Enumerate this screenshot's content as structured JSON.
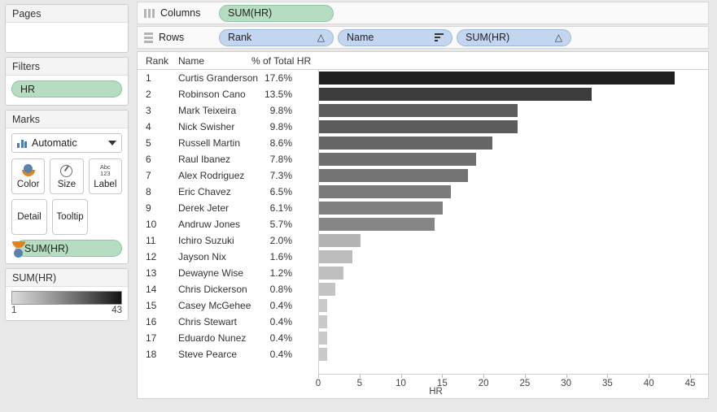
{
  "left_panel": {
    "pages": {
      "title": "Pages"
    },
    "filters": {
      "title": "Filters",
      "pills": [
        {
          "label": "HR"
        }
      ]
    },
    "marks": {
      "title": "Marks",
      "mark_type": "Automatic",
      "buttons": [
        {
          "label": "Color",
          "icon": "color-icon"
        },
        {
          "label": "Size",
          "icon": "size-icon"
        },
        {
          "label": "Label",
          "icon": "abc-123-icon"
        },
        {
          "label": "Detail",
          "icon": ""
        },
        {
          "label": "Tooltip",
          "icon": ""
        }
      ],
      "encoding_pills": [
        {
          "label": "SUM(HR)",
          "icon": "color-icon"
        }
      ]
    },
    "legend": {
      "title": "SUM(HR)",
      "min": "1",
      "max": "43",
      "gradient_start": "#dcdcdc",
      "gradient_end": "#141414"
    }
  },
  "shelves": {
    "columns": {
      "label": "Columns",
      "pills": [
        {
          "label": "SUM(HR)",
          "type": "measure",
          "indicator": ""
        }
      ]
    },
    "rows": {
      "label": "Rows",
      "pills": [
        {
          "label": "Rank",
          "type": "dimension",
          "indicator": "sort-asc"
        },
        {
          "label": "Name",
          "type": "dimension",
          "indicator": "sort-bars"
        },
        {
          "label": "SUM(HR)",
          "type": "dimension",
          "indicator": "sort-asc"
        }
      ]
    }
  },
  "view": {
    "headers": {
      "rank": "Rank",
      "name": "Name",
      "pct": "% of Total HR"
    },
    "rows": [
      {
        "rank": "1",
        "name": "Curtis Granderson",
        "pct": "17.6%",
        "hr": 43,
        "color": "#1f1f1f"
      },
      {
        "rank": "2",
        "name": "Robinson Cano",
        "pct": "13.5%",
        "hr": 33,
        "color": "#3c3c3c"
      },
      {
        "rank": "3",
        "name": "Mark Teixeira",
        "pct": "9.8%",
        "hr": 24,
        "color": "#5c5c5c"
      },
      {
        "rank": "4",
        "name": "Nick Swisher",
        "pct": "9.8%",
        "hr": 24,
        "color": "#5c5c5c"
      },
      {
        "rank": "5",
        "name": "Russell Martin",
        "pct": "8.6%",
        "hr": 21,
        "color": "#666666"
      },
      {
        "rank": "6",
        "name": "Raul Ibanez",
        "pct": "7.8%",
        "hr": 19,
        "color": "#6e6e6e"
      },
      {
        "rank": "7",
        "name": "Alex Rodriguez",
        "pct": "7.3%",
        "hr": 18,
        "color": "#737373"
      },
      {
        "rank": "8",
        "name": "Eric Chavez",
        "pct": "6.5%",
        "hr": 16,
        "color": "#7b7b7b"
      },
      {
        "rank": "9",
        "name": "Derek Jeter",
        "pct": "6.1%",
        "hr": 15,
        "color": "#808080"
      },
      {
        "rank": "10",
        "name": "Andruw Jones",
        "pct": "5.7%",
        "hr": 14,
        "color": "#868686"
      },
      {
        "rank": "11",
        "name": "Ichiro Suzuki",
        "pct": "2.0%",
        "hr": 5,
        "color": "#b3b3b3"
      },
      {
        "rank": "12",
        "name": "Jayson Nix",
        "pct": "1.6%",
        "hr": 4,
        "color": "#bcbcbc"
      },
      {
        "rank": "13",
        "name": "Dewayne Wise",
        "pct": "1.2%",
        "hr": 3,
        "color": "#bfbfbf"
      },
      {
        "rank": "14",
        "name": "Chris Dickerson",
        "pct": "0.8%",
        "hr": 2,
        "color": "#c4c4c4"
      },
      {
        "rank": "15",
        "name": "Casey McGehee",
        "pct": "0.4%",
        "hr": 1,
        "color": "#c9c9c9"
      },
      {
        "rank": "16",
        "name": "Chris Stewart",
        "pct": "0.4%",
        "hr": 1,
        "color": "#c9c9c9"
      },
      {
        "rank": "17",
        "name": "Eduardo Nunez",
        "pct": "0.4%",
        "hr": 1,
        "color": "#c9c9c9"
      },
      {
        "rank": "18",
        "name": "Steve Pearce",
        "pct": "0.4%",
        "hr": 1,
        "color": "#c9c9c9"
      }
    ]
  },
  "chart_data": {
    "type": "bar",
    "title": "",
    "xlabel": "HR",
    "ylabel": "",
    "orientation": "horizontal",
    "xlim": [
      0,
      45
    ],
    "xticks": [
      0,
      5,
      10,
      15,
      20,
      25,
      30,
      35,
      40,
      45
    ],
    "grid": false,
    "legend": {
      "title": "SUM(HR)",
      "position": "left-panel",
      "min": 1,
      "max": 43,
      "type": "sequential-gray"
    },
    "categories": [
      "Curtis Granderson",
      "Robinson Cano",
      "Mark Teixeira",
      "Nick Swisher",
      "Russell Martin",
      "Raul Ibanez",
      "Alex Rodriguez",
      "Eric Chavez",
      "Derek Jeter",
      "Andruw Jones",
      "Ichiro Suzuki",
      "Jayson Nix",
      "Dewayne Wise",
      "Chris Dickerson",
      "Casey McGehee",
      "Chris Stewart",
      "Eduardo Nunez",
      "Steve Pearce"
    ],
    "values": [
      43,
      33,
      24,
      24,
      21,
      19,
      18,
      16,
      15,
      14,
      5,
      4,
      3,
      2,
      1,
      1,
      1,
      1
    ],
    "percent_of_total": [
      "17.6%",
      "13.5%",
      "9.8%",
      "9.8%",
      "8.6%",
      "7.8%",
      "7.3%",
      "6.5%",
      "6.1%",
      "5.7%",
      "2.0%",
      "1.6%",
      "1.2%",
      "0.8%",
      "0.4%",
      "0.4%",
      "0.4%",
      "0.4%"
    ],
    "ranks": [
      1,
      2,
      3,
      4,
      5,
      6,
      7,
      8,
      9,
      10,
      11,
      12,
      13,
      14,
      15,
      16,
      17,
      18
    ]
  }
}
